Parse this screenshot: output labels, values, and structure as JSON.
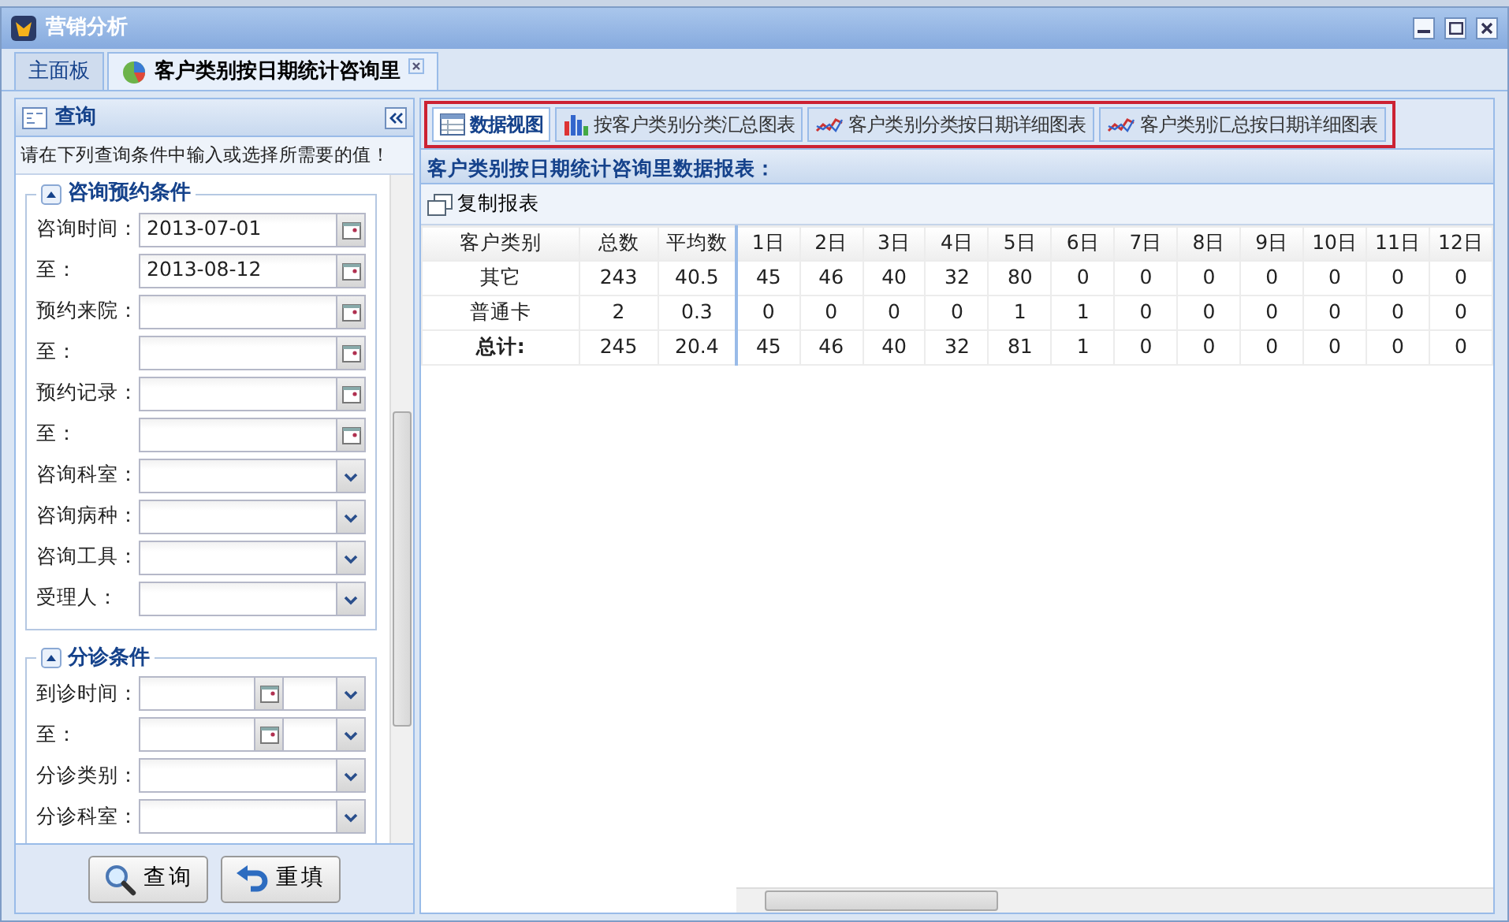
{
  "window": {
    "title": "营销分析"
  },
  "window_tabs": [
    {
      "label": "主面板",
      "selected": false,
      "closable": false
    },
    {
      "label": "客户类别按日期统计咨询里",
      "selected": true,
      "closable": true
    }
  ],
  "query_panel": {
    "title": "查询",
    "hint": "请在下列查询条件中输入或选择所需要的值！",
    "groups": [
      {
        "title": "咨询预约条件",
        "expanded": true,
        "fields": [
          {
            "label": "咨询时间：",
            "kind": "date",
            "value": "2013-07-01"
          },
          {
            "label": "至：",
            "kind": "date",
            "value": "2013-08-12"
          },
          {
            "label": "预约来院：",
            "kind": "date"
          },
          {
            "label": "至：",
            "kind": "date"
          },
          {
            "label": "预约记录：",
            "kind": "date"
          },
          {
            "label": "至：",
            "kind": "date"
          },
          {
            "label": "咨询科室：",
            "kind": "select"
          },
          {
            "label": "咨询病种：",
            "kind": "select"
          },
          {
            "label": "咨询工具：",
            "kind": "select"
          },
          {
            "label": "受理人：",
            "kind": "select"
          }
        ]
      },
      {
        "title": "分诊条件",
        "expanded": true,
        "fields": [
          {
            "label": "到诊时间：",
            "kind": "datetime"
          },
          {
            "label": "至：",
            "kind": "datetime"
          },
          {
            "label": "分诊类别：",
            "kind": "select"
          },
          {
            "label": "分诊科室：",
            "kind": "select"
          }
        ]
      }
    ],
    "buttons": [
      {
        "label": "查询",
        "kind": "search"
      },
      {
        "label": "重填",
        "kind": "reset"
      }
    ]
  },
  "report_tabs": [
    {
      "label": "数据视图",
      "selected": true,
      "kind": "grid"
    },
    {
      "label": "按客户类别分类汇总图表",
      "selected": false,
      "kind": "bar"
    },
    {
      "label": "客户类别分类按日期详细图表",
      "selected": false,
      "kind": "line"
    },
    {
      "label": "客户类别汇总按日期详细图表",
      "selected": false,
      "kind": "line"
    }
  ],
  "report": {
    "title": "客户类别按日期统计咨询里数据报表：",
    "toolbar": [
      "复制报表"
    ],
    "columns": [
      "客户类别",
      "总数",
      "平均数",
      "1日",
      "2日",
      "3日",
      "4日",
      "5日",
      "6日",
      "7日",
      "8日",
      "9日",
      "10日",
      "11日",
      "12日"
    ],
    "rows": [
      {
        "total": false,
        "cells": [
          "其它",
          "243",
          "40.5",
          "45",
          "46",
          "40",
          "32",
          "80",
          "0",
          "0",
          "0",
          "0",
          "0",
          "0",
          "0"
        ]
      },
      {
        "total": false,
        "cells": [
          "普通卡",
          "2",
          "0.3",
          "0",
          "0",
          "0",
          "0",
          "1",
          "1",
          "0",
          "0",
          "0",
          "0",
          "0",
          "0"
        ]
      },
      {
        "total": true,
        "cells": [
          "总计:",
          "245",
          "20.4",
          "45",
          "46",
          "40",
          "32",
          "81",
          "1",
          "0",
          "0",
          "0",
          "0",
          "0",
          "0"
        ]
      }
    ]
  }
}
